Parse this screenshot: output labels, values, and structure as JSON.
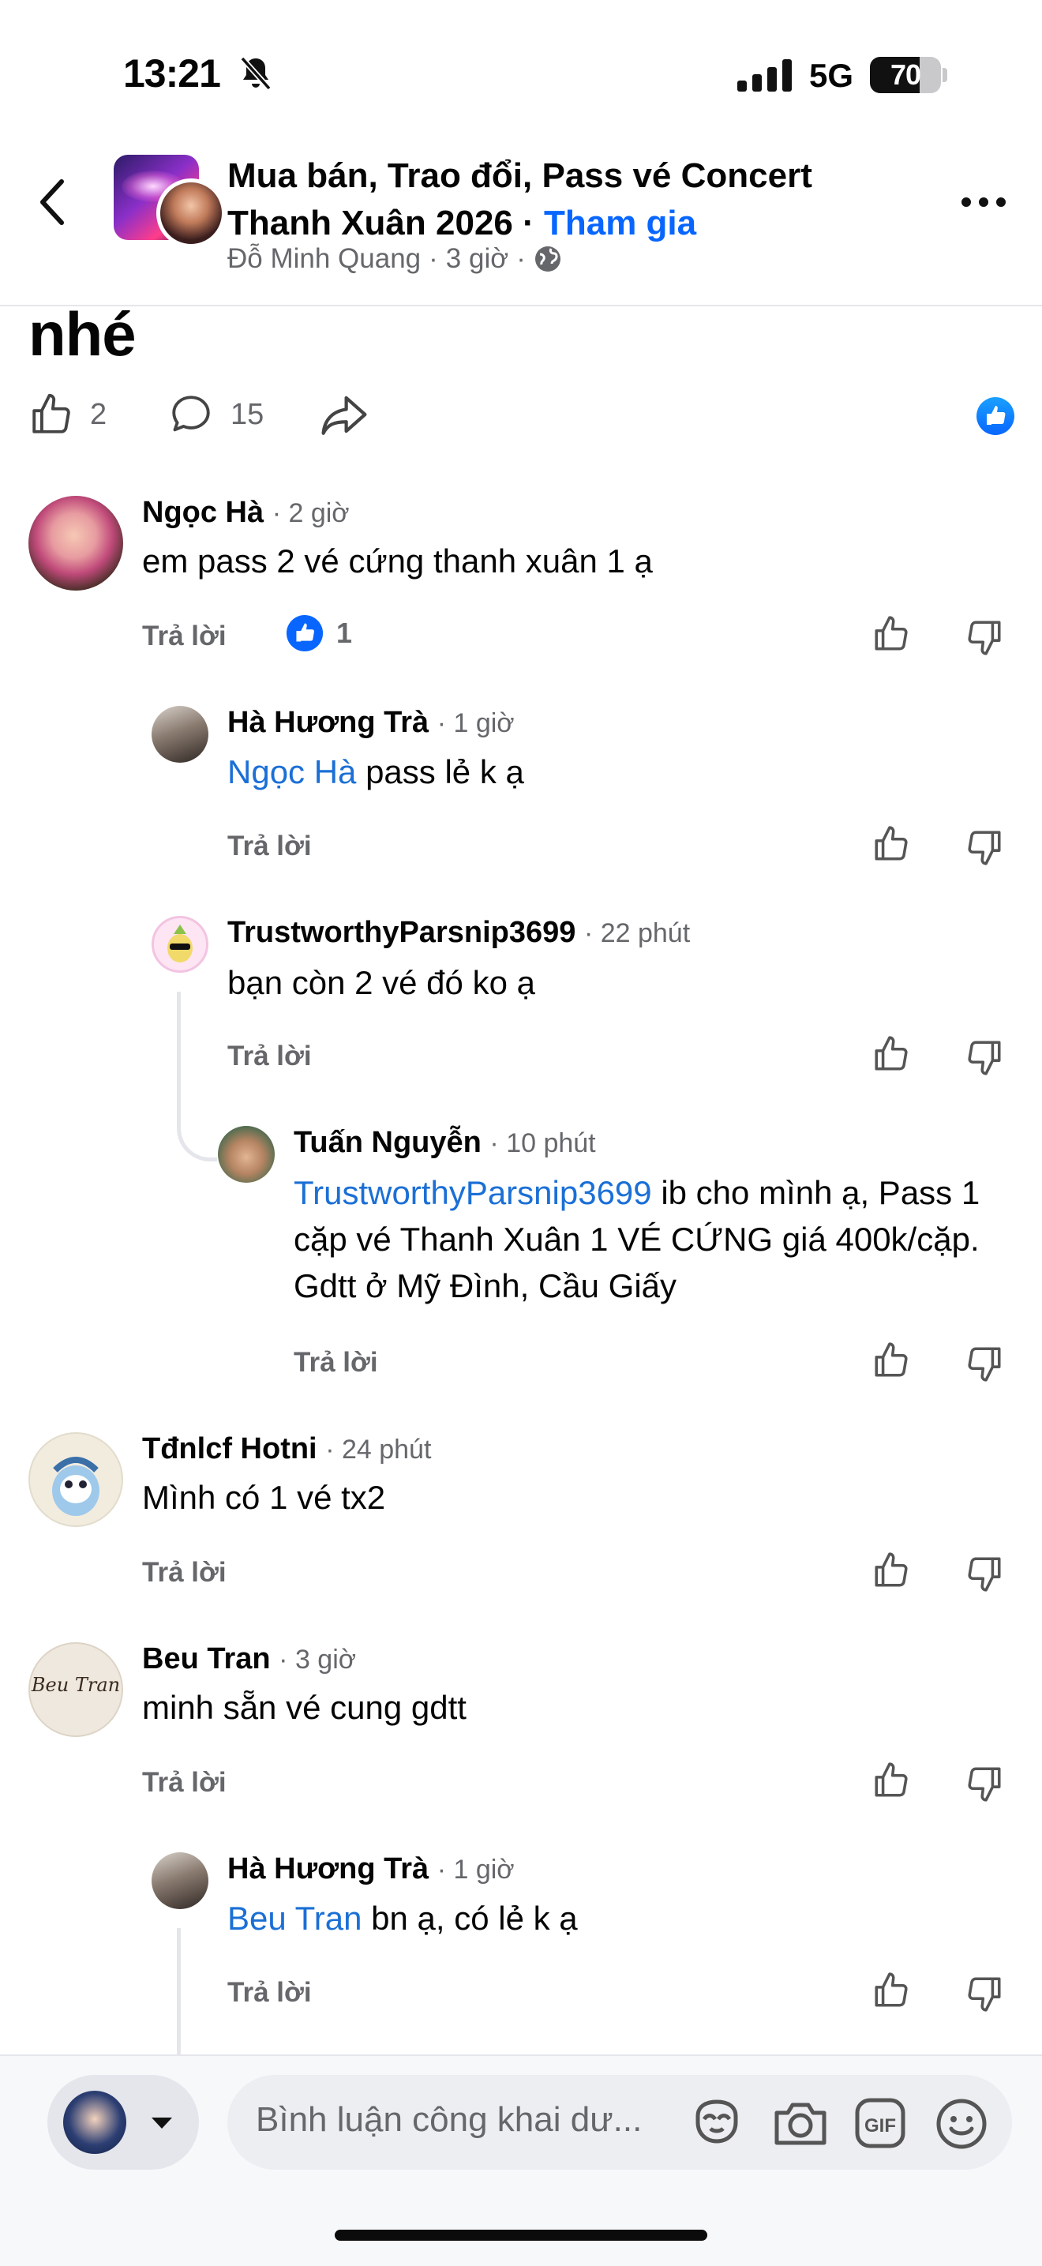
{
  "status_bar": {
    "time": "13:21",
    "network": "5G",
    "battery": "70",
    "battery_level": 0.7
  },
  "header": {
    "group_title": "Mua bán, Trao đổi, Pass vé Concert Thanh Xuân 2026 · ",
    "join_label": "Tham gia",
    "author": "Đỗ Minh Quang",
    "post_age": "3 giờ",
    "separator": "·"
  },
  "post": {
    "text_tail": "nhé",
    "like_count": "2",
    "comment_count": "15"
  },
  "comment_actions": {
    "reply_label": "Trả lời"
  },
  "comments": [
    {
      "name": "Ngọc Hà",
      "time": "· 2 giờ",
      "text": "em pass 2 vé cứng thanh xuân 1 ạ",
      "reaction_count": "1"
    },
    {
      "name": "Hà Hương Trà",
      "time": "· 1 giờ",
      "mention": "Ngọc Hà",
      "text": " pass lẻ k ạ"
    },
    {
      "name": "TrustworthyParsnip3699",
      "time": "· 22 phút",
      "text": "bạn còn 2 vé đó ko ạ"
    },
    {
      "name": "Tuấn Nguyễn",
      "time": "· 10 phút",
      "mention": "TrustworthyParsnip3699",
      "text": " ib cho mình ạ, Pass 1 cặp vé Thanh Xuân 1 VÉ CỨNG giá 400k/cặp. Gdtt ở Mỹ Đình, Cầu Giấy"
    },
    {
      "name": "Tđnlcf Hotni",
      "time": "· 24 phút",
      "text": "Mình có 1 vé tx2"
    },
    {
      "name": "Beu Tran",
      "time": "· 3 giờ",
      "text": "minh sẵn vé cung gdtt",
      "avatar_text": "Beu Tran"
    },
    {
      "name": "Hà Hương Trà",
      "time": "· 1 giờ",
      "mention": "Beu Tran",
      "text": " bn ạ, có lẻ k ạ"
    }
  ],
  "composer": {
    "placeholder": "Bình luận công khai dư..."
  },
  "colors": {
    "accent": "#0866ff",
    "mention": "#1b6fd6",
    "muted": "#65676b",
    "divider": "#e4e6eb"
  },
  "icons": [
    "back-arrow-icon",
    "more-icon",
    "globe-icon",
    "like-icon",
    "comment-icon",
    "share-icon",
    "like-reaction-icon",
    "thumbs-up-icon",
    "thumbs-down-icon",
    "chevron-down-icon",
    "avatar-stickers-icon",
    "camera-icon",
    "gif-icon",
    "emoji-icon",
    "signal-icon",
    "mute-bell-icon"
  ]
}
